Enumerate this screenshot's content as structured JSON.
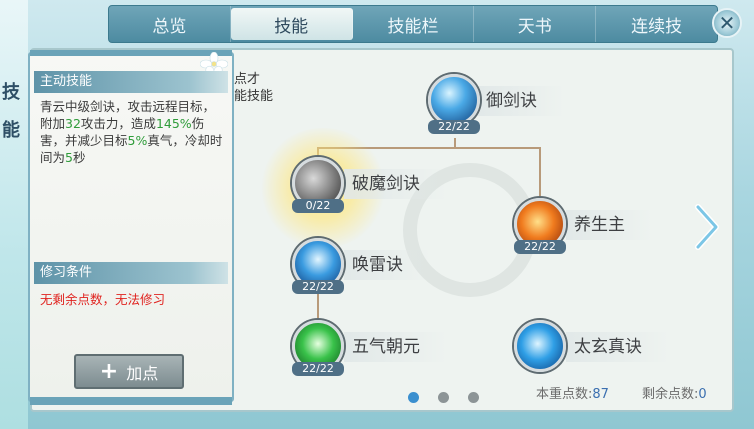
{
  "side_label": [
    "技",
    "能"
  ],
  "tabs": [
    {
      "label": "总览",
      "active": false
    },
    {
      "label": "技能",
      "active": true
    },
    {
      "label": "技能栏",
      "active": false
    },
    {
      "label": "天书",
      "active": false
    },
    {
      "label": "连续技",
      "active": false
    }
  ],
  "close_icon": "close-icon",
  "info": {
    "active_skill_header": "主动技能",
    "desc_a": "青云中级剑诀，攻击远程目标，附加",
    "desc_attack": "32",
    "desc_b": "攻击力，造成",
    "desc_pct": "145%",
    "desc_c": "伤害，并减少目标",
    "desc_reduce": "5%",
    "desc_d": "真气，冷却时间为",
    "desc_cd": "5",
    "desc_e": "秒",
    "condition_header": "修习条件",
    "condition_text": "无剩余点数，无法修习",
    "add_button": "加点"
  },
  "partial_text": [
    "点才",
    "能技能"
  ],
  "skills": {
    "yujian": {
      "name": "御剑诀",
      "level": "22/22"
    },
    "pomo": {
      "name": "破魔剑诀",
      "level": "0/22"
    },
    "yangsheng": {
      "name": "养生主",
      "level": "22/22"
    },
    "huanlei": {
      "name": "唤雷诀",
      "level": "22/22"
    },
    "wuqi": {
      "name": "五气朝元",
      "level": "22/22"
    },
    "taixuan": {
      "name": "太玄真诀",
      "level": "22/22"
    }
  },
  "points": {
    "weight_label": "本重点数:",
    "weight_value": "87",
    "remain_label": "剩余点数:",
    "remain_value": "0"
  },
  "page_dots": {
    "count": 3,
    "active": 0
  },
  "colors": {
    "accent": "#3a8fcf",
    "warning": "#e0231f",
    "highlight": "#2f9c3a"
  }
}
